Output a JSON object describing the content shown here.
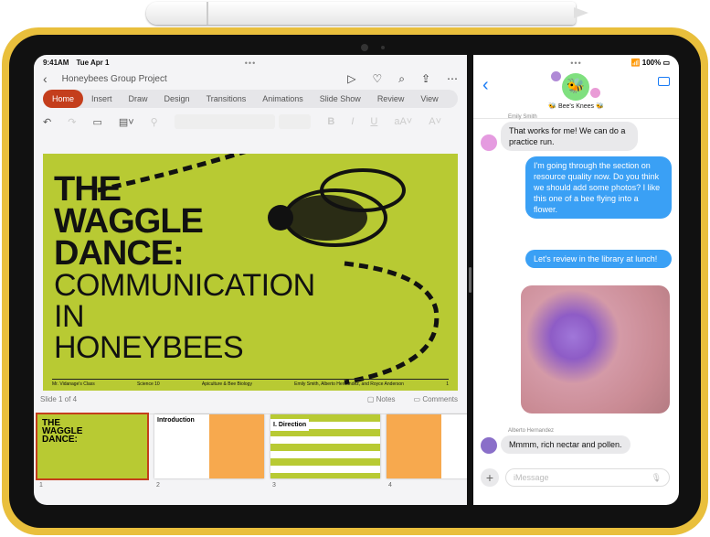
{
  "ppt": {
    "status": {
      "time": "9:41AM",
      "date": "Tue Apr 1"
    },
    "doc_title": "Honeybees Group Project",
    "tabs": [
      "Home",
      "Insert",
      "Draw",
      "Design",
      "Transitions",
      "Animations",
      "Slide Show",
      "Review",
      "View"
    ],
    "active_tab": "Home",
    "slide": {
      "title": [
        "THE",
        "WAGGLE",
        "DANCE:"
      ],
      "subtitle": [
        "COMMUNICATION",
        "IN",
        "HONEYBEES"
      ],
      "footer": [
        "Mr. Vidanage's Class",
        "Science 10",
        "Apiculture & Bee Biology",
        "Emily Smith, Alberto Hernandez, and Royce Anderson",
        "1"
      ]
    },
    "slide_counter": "Slide 1 of 4",
    "notes_label": "Notes",
    "comments_label": "Comments",
    "thumbnails": [
      {
        "num": "1",
        "title": "THE WAGGLE DANCE:"
      },
      {
        "num": "2",
        "title": "Introduction"
      },
      {
        "num": "3",
        "title": "I. Direction"
      },
      {
        "num": "4",
        "title": ""
      }
    ],
    "accent": "#c43e1c",
    "slide_color": "#b8ca33"
  },
  "messages": {
    "battery": "100%",
    "group_name": "🐝 Bee's Knees 🐝",
    "thread": [
      {
        "sender": "Emily Smith",
        "text": "That works for me! We can do a practice run.",
        "dir": "in"
      },
      {
        "text": "I'm going through the section on resource quality now. Do you think we should add some photos? I like this one of a bee flying into a flower.",
        "dir": "out"
      },
      {
        "text": "Let's review in the library at lunch!",
        "dir": "out"
      },
      {
        "sender": "Alberto Hernandez",
        "text": "Mmmm, rich nectar and pollen.",
        "dir": "in"
      }
    ],
    "input_placeholder": "iMessage",
    "bubble_color": "#3aa0f5"
  }
}
